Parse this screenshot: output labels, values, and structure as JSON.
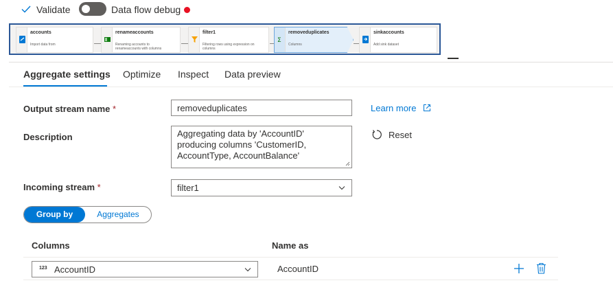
{
  "toolbar": {
    "validate_label": "Validate",
    "debug_label": "Data flow debug",
    "debug_on": false,
    "status_color": "#e81123"
  },
  "flow_nodes": [
    {
      "title": "accounts",
      "subtitle": "Import data from",
      "icon": "source-icon",
      "selected": false
    },
    {
      "title": "renameaccounts",
      "subtitle": "Renaming accounts to renameaccounts with columns",
      "icon": "select-icon",
      "selected": false
    },
    {
      "title": "filter1",
      "subtitle": "Filtering rows using expression on columns",
      "icon": "filter-icon",
      "selected": false
    },
    {
      "title": "removeduplicates",
      "subtitle": "Columns",
      "icon": "aggregate-icon",
      "selected": true
    },
    {
      "title": "sinkaccounts",
      "subtitle": "Add sink dataset",
      "icon": "sink-icon",
      "selected": false
    }
  ],
  "tabs": [
    {
      "label": "Aggregate settings",
      "active": true
    },
    {
      "label": "Optimize",
      "active": false
    },
    {
      "label": "Inspect",
      "active": false
    },
    {
      "label": "Data preview",
      "active": false
    }
  ],
  "form": {
    "output_stream_label": "Output stream name",
    "output_stream_value": "removeduplicates",
    "description_label": "Description",
    "description_lines": [
      "Aggregating data by 'AccountID'",
      "producing columns 'CustomerID,",
      "AccountType, AccountBalance'"
    ],
    "incoming_stream_label": "Incoming stream",
    "incoming_stream_value": "filter1",
    "required_mark": "*",
    "learn_more": "Learn more",
    "reset": "Reset"
  },
  "segment": {
    "group_by": "Group by",
    "aggregates": "Aggregates",
    "active": "group_by"
  },
  "table": {
    "col_header": "Columns",
    "name_as_header": "Name as",
    "rows": [
      {
        "type_badge": "123",
        "column": "AccountID",
        "name_as": "AccountID"
      }
    ]
  },
  "colors": {
    "accent": "#0078d4",
    "required": "#a4262c"
  }
}
